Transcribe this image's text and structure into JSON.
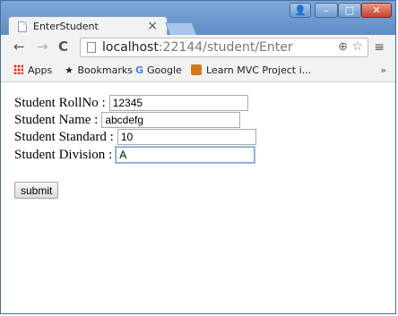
{
  "tab": {
    "title": "EnterStudent",
    "close_glyph": "×"
  },
  "window_controls": {
    "user_glyph": "👤",
    "minimize_glyph": "–",
    "maximize_glyph": "□",
    "close_glyph": "✕"
  },
  "toolbar": {
    "url_host": "localhost",
    "url_rest": ":22144/student/Enter",
    "back_glyph": "←",
    "forward_glyph": "→",
    "reload_glyph": "C",
    "zoom_glyph": "⊕",
    "star_glyph": "☆",
    "menu_glyph": "≡"
  },
  "bookmarks": {
    "apps": "Apps",
    "bookmarks": "Bookmarks",
    "google": "Google",
    "mvc": "Learn MVC Project i...",
    "more": "»"
  },
  "form": {
    "rollno_label": "Student RollNo :",
    "rollno_value": "12345",
    "name_label": "Student Name :",
    "name_value": "abcdefg",
    "standard_label": "Student Standard :",
    "standard_value": "10",
    "division_label": "Student Division :",
    "division_value": "A",
    "submit_label": "submit"
  }
}
